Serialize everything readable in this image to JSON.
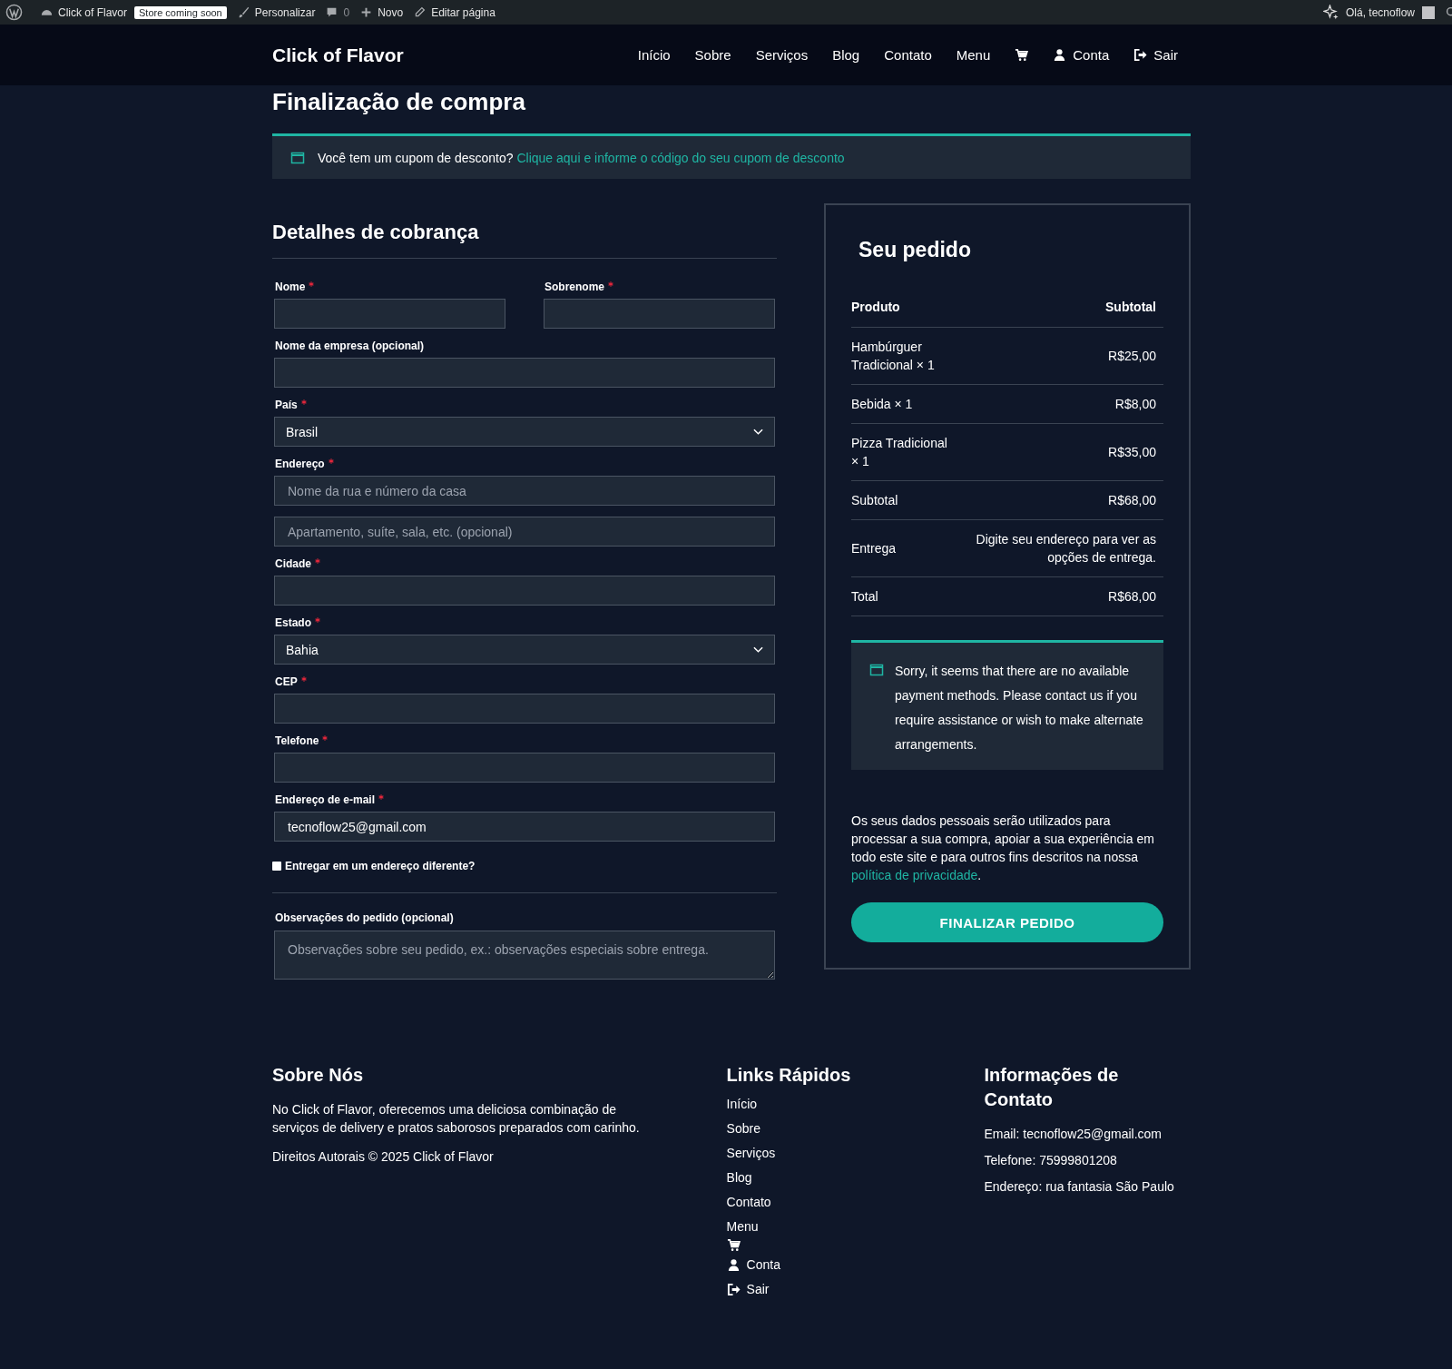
{
  "admin_bar": {
    "site": "Click of Flavor",
    "badge": "Store coming soon",
    "items": [
      {
        "kind": "customize",
        "label": "Personalizar"
      },
      {
        "kind": "comments",
        "label": "0"
      },
      {
        "kind": "new",
        "label": "Novo"
      },
      {
        "kind": "edit",
        "label": "Editar página"
      }
    ],
    "greeting": "Olá, tecnoflow"
  },
  "header": {
    "logo": "Click of Flavor",
    "nav": [
      {
        "kind": "link",
        "label": "Início"
      },
      {
        "kind": "link",
        "label": "Sobre"
      },
      {
        "kind": "link",
        "label": "Serviços"
      },
      {
        "kind": "link",
        "label": "Blog"
      },
      {
        "kind": "link",
        "label": "Contato"
      },
      {
        "kind": "link",
        "label": "Menu"
      },
      {
        "kind": "cart"
      },
      {
        "kind": "account",
        "label": "Conta"
      },
      {
        "kind": "logout",
        "label": "Sair"
      }
    ]
  },
  "page_title": "Finalização de compra",
  "coupon_notice": {
    "text": "Você tem um cupom de desconto?",
    "link": "Clique aqui e informe o código do seu cupom de desconto"
  },
  "billing": {
    "title": "Detalhes de cobrança",
    "rows": [
      [
        {
          "kind": "text",
          "label": "Nome",
          "required": true
        },
        {
          "kind": "text",
          "label": "Sobrenome",
          "required": true
        }
      ],
      [
        {
          "kind": "text",
          "label": "Nome da empresa (opcional)",
          "required": false
        }
      ],
      [
        {
          "kind": "select",
          "label": "País",
          "required": true,
          "value": "Brasil"
        }
      ],
      [
        {
          "kind": "text",
          "label": "Endereço",
          "required": true,
          "placeholder": "Nome da rua e número da casa"
        }
      ],
      [
        {
          "kind": "text",
          "placeholder": "Apartamento, suíte, sala, etc. (opcional)"
        }
      ],
      [
        {
          "kind": "text",
          "label": "Cidade",
          "required": true
        }
      ],
      [
        {
          "kind": "select",
          "label": "Estado",
          "required": true,
          "value": "Bahia"
        }
      ],
      [
        {
          "kind": "text",
          "label": "CEP",
          "required": true
        }
      ],
      [
        {
          "kind": "text",
          "label": "Telefone",
          "required": true
        }
      ],
      [
        {
          "kind": "text",
          "label": "Endereço de e-mail",
          "required": true,
          "value": "tecnoflow25@gmail.com"
        }
      ]
    ],
    "ship_different": {
      "label": "Entregar em um endereço diferente?",
      "checked": false
    },
    "notes": {
      "label": "Observações do pedido (opcional)",
      "placeholder": "Observações sobre seu pedido, ex.: observações especiais sobre entrega."
    }
  },
  "order": {
    "title": "Seu pedido",
    "columns": [
      "Produto",
      "Subtotal"
    ],
    "items": [
      {
        "name": "Hambúrguer Tradicional × 1",
        "price": "R$25,00"
      },
      {
        "name": "Bebida × 1",
        "price": "R$8,00"
      },
      {
        "name": "Pizza Tradicional × 1",
        "price": "R$35,00"
      }
    ],
    "totals": [
      {
        "label": "Subtotal",
        "value": "R$68,00"
      },
      {
        "label": "Entrega",
        "value": "Digite seu endereço para ver as opções de entrega."
      },
      {
        "label": "Total",
        "value": "R$68,00"
      }
    ],
    "payment_notice": "Sorry, it seems that there are no available payment methods. Please contact us if you require assistance or wish to make alternate arrangements.",
    "privacy_text": "Os seus dados pessoais serão utilizados para processar a sua compra, apoiar a sua experiência em todo este site e para outros fins descritos na nossa",
    "privacy_link": "política de privacidade",
    "privacy_end": ".",
    "button": "FINALIZAR PEDIDO"
  },
  "footer": {
    "about": {
      "title": "Sobre Nós",
      "text": "No Click of Flavor, oferecemos uma deliciosa combinação de serviços de delivery e pratos saborosos preparados com carinho.",
      "copyright": "Direitos Autorais © 2025 Click of Flavor"
    },
    "links": {
      "title": "Links Rápidos",
      "items": [
        {
          "kind": "link",
          "label": "Início"
        },
        {
          "kind": "link",
          "label": "Sobre"
        },
        {
          "kind": "link",
          "label": "Serviços"
        },
        {
          "kind": "link",
          "label": "Blog"
        },
        {
          "kind": "link",
          "label": "Contato"
        },
        {
          "kind": "link",
          "label": "Menu"
        },
        {
          "kind": "cart"
        },
        {
          "kind": "account",
          "label": "Conta"
        },
        {
          "kind": "logout",
          "label": "Sair"
        }
      ]
    },
    "contact": {
      "title": "Informações de Contato",
      "lines": [
        "Email: tecnoflow25@gmail.com",
        "Telefone: 75999801208",
        "Endereço: rua fantasia São Paulo"
      ]
    }
  }
}
